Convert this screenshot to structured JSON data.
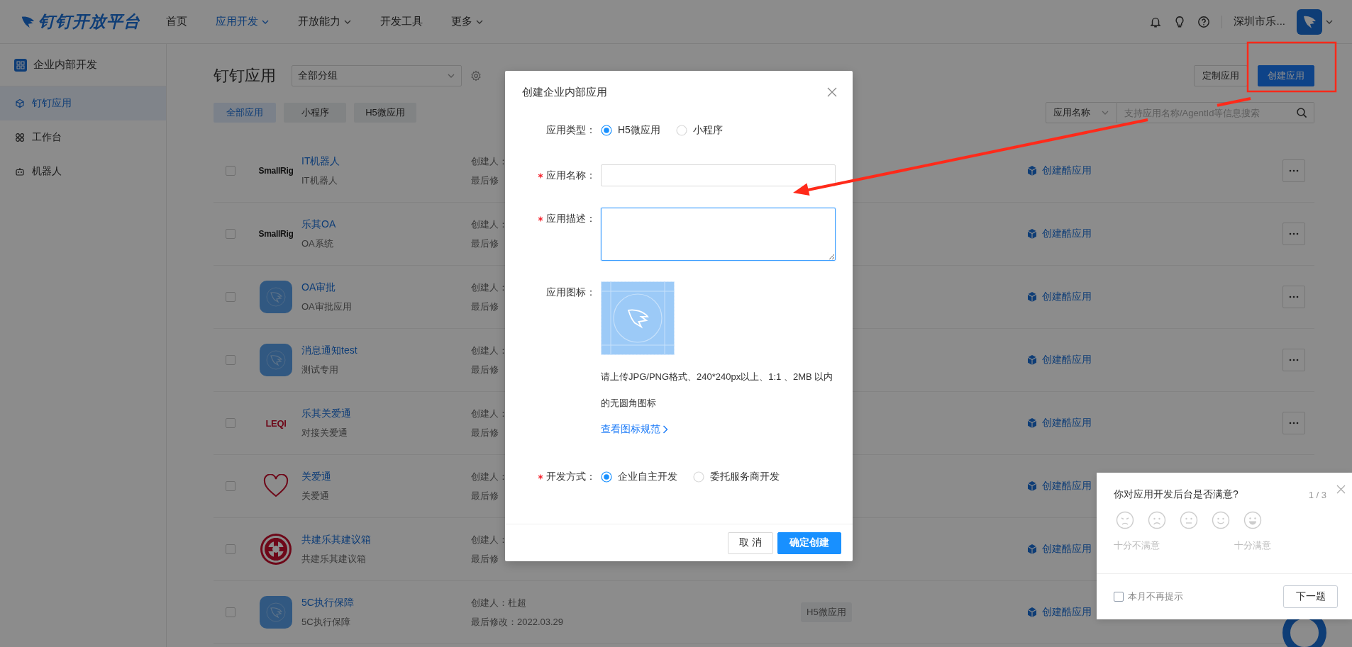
{
  "header": {
    "logo": "钉钉开放平台",
    "nav": [
      {
        "label": "首页",
        "selected": false,
        "dropdown": false
      },
      {
        "label": "应用开发",
        "selected": true,
        "dropdown": true
      },
      {
        "label": "开放能力",
        "selected": false,
        "dropdown": true
      },
      {
        "label": "开发工具",
        "selected": false,
        "dropdown": false
      },
      {
        "label": "更多",
        "selected": false,
        "dropdown": true
      }
    ],
    "org": "深圳市乐..."
  },
  "sidebar": {
    "title": "企业内部开发",
    "items": [
      {
        "label": "钉钉应用",
        "selected": true
      },
      {
        "label": "工作台",
        "selected": false
      },
      {
        "label": "机器人",
        "selected": false
      }
    ]
  },
  "page": {
    "title": "钉钉应用",
    "group_select": "全部分组",
    "buttons": [
      {
        "label": "定制应用",
        "kind": "default"
      },
      {
        "label": "创建应用",
        "kind": "primary"
      }
    ],
    "filters": [
      {
        "label": "全部应用",
        "selected": true
      },
      {
        "label": "小程序",
        "selected": false
      },
      {
        "label": "H5微应用",
        "selected": false
      }
    ],
    "search": {
      "field": "应用名称",
      "placeholder": "支持应用名称/AgentId等信息搜索"
    }
  },
  "apps": [
    {
      "checked": false,
      "logo": {
        "kind": "wordmark",
        "text": "SmallRig"
      },
      "name": "IT机器人",
      "description": "IT机器人",
      "creator": "创建人：",
      "modified": "最后修",
      "action": "创建酷应用",
      "menu": true
    },
    {
      "checked": false,
      "logo": {
        "kind": "wordmark",
        "text": "SmallRig"
      },
      "name": "乐其OA",
      "description": "OA系统",
      "creator": "创建人：",
      "modified": "最后修",
      "action": "创建酷应用",
      "menu": true
    },
    {
      "checked": false,
      "logo": {
        "kind": "app"
      },
      "name": "OA审批",
      "description": "OA审批应用",
      "creator": "创建人：",
      "modified": "最后修",
      "action": "创建酷应用",
      "menu": true
    },
    {
      "checked": false,
      "logo": {
        "kind": "app"
      },
      "name": "消息通知test",
      "description": "测试专用",
      "creator": "创建人：",
      "modified": "最后修",
      "action": "创建酷应用",
      "menu": true
    },
    {
      "checked": false,
      "logo": {
        "kind": "logotype",
        "text": "LEQI"
      },
      "name": "乐其关爱通",
      "description": "对接关爱通",
      "creator": "创建人：",
      "modified": "最后修",
      "action": "创建酷应用",
      "menu": true
    },
    {
      "checked": false,
      "logo": {
        "kind": "heart"
      },
      "name": "关爱通",
      "description": "关爱通",
      "creator": "创建人：",
      "modified": "最后修",
      "action": "创建酷应用"
    },
    {
      "checked": false,
      "logo": {
        "kind": "emblem"
      },
      "name": "共建乐其建议箱",
      "description": "共建乐其建议箱",
      "creator": "创建人：",
      "modified": "最后修",
      "action": "创建酷应用"
    },
    {
      "checked": false,
      "logo": {
        "kind": "app"
      },
      "name": "5C执行保障",
      "description": "5C执行保障",
      "creator": "创建人：杜超",
      "modified": "最后修改：2022.03.29",
      "type": "H5微应用",
      "action": "创建酷应用"
    }
  ],
  "dialog": {
    "title": "创建企业内部应用",
    "fields": [
      {
        "kind": "radio",
        "label": "应用类型：",
        "required": false,
        "options": [
          {
            "label": "H5微应用",
            "selected": true
          },
          {
            "label": "小程序",
            "selected": false
          }
        ]
      },
      {
        "kind": "input",
        "label": "应用名称：",
        "required": true,
        "focused": false
      },
      {
        "kind": "textarea",
        "label": "应用描述：",
        "required": true,
        "focused": true
      },
      {
        "kind": "upload",
        "label": "应用图标：",
        "required": false,
        "hint": "请上传JPG/PNG格式、240*240px以上、1:1 、2MB 以内的无圆角图标",
        "link": "查看图标规范"
      },
      {
        "kind": "radio",
        "label": "开发方式：",
        "required": true,
        "options": [
          {
            "label": "企业自主开发",
            "selected": true
          },
          {
            "label": "委托服务商开发",
            "selected": false
          }
        ]
      }
    ],
    "buttons": [
      {
        "label": "取 消",
        "kind": "default"
      },
      {
        "label": "确定创建",
        "kind": "primary"
      }
    ]
  },
  "survey": {
    "question": "你对应用开发后台是否满意?",
    "counter": "1 / 3",
    "low_label": "十分不满意",
    "high_label": "十分满意",
    "opt_out": {
      "label": "本月不再提示",
      "checked": false
    },
    "next": "下一题"
  }
}
